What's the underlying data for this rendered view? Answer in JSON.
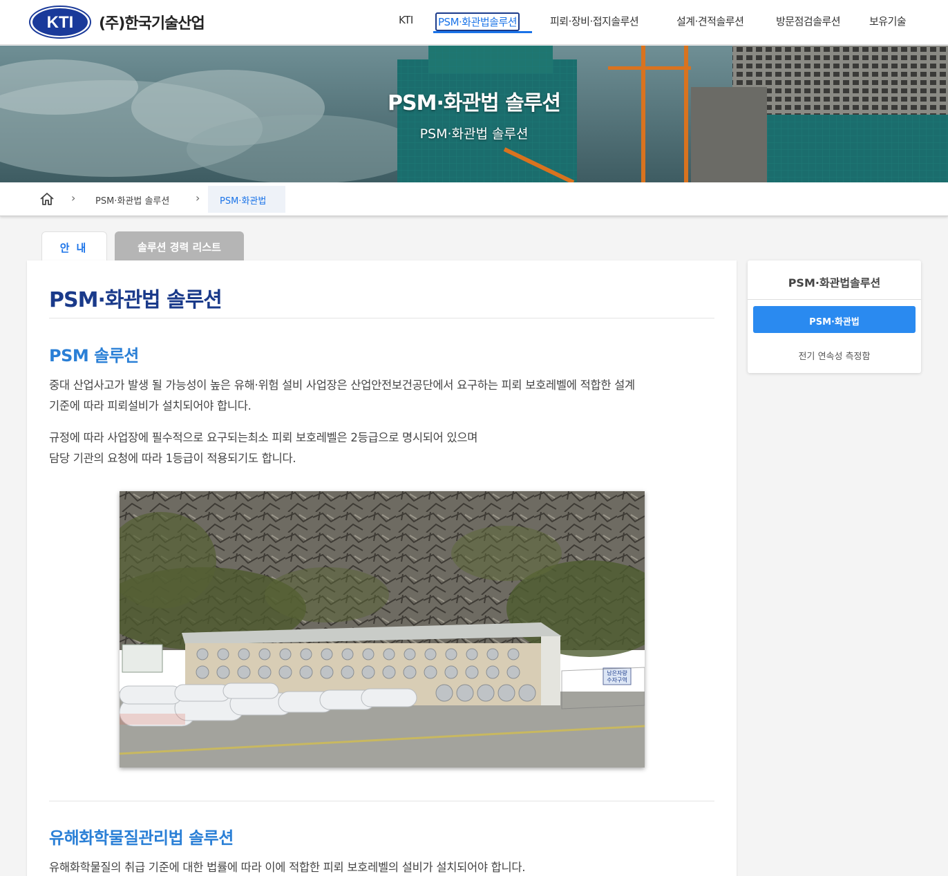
{
  "header": {
    "logo_text": "KTI",
    "company": "(주)한국기술산업",
    "nav": [
      {
        "label": "KTI"
      },
      {
        "label": "PSM·화관법솔루션"
      },
      {
        "label": "피뢰·장비·접지솔루션"
      },
      {
        "label": "설계·견적솔루션"
      },
      {
        "label": "방문점검솔루션"
      },
      {
        "label": "보유기술"
      }
    ],
    "active_nav_index": 1
  },
  "banner": {
    "title": "PSM·화관법 솔루션",
    "subtitle": "PSM·화관법 솔루션"
  },
  "breadcrumb": {
    "items": [
      "PSM·화관법 솔루션"
    ],
    "current": "PSM·화관법"
  },
  "tabs": [
    {
      "label": "안내",
      "active": true
    },
    {
      "label": "솔루션 경력 리스트",
      "active": false
    }
  ],
  "main": {
    "title": "PSM·화관법 솔루션",
    "section1": {
      "title": "PSM 솔루션",
      "para1_line1": "중대 산업사고가 발생 될 가능성이 높은 유해·위험 설비 사업장은 산업안전보건공단에서 요구하는 피뢰 보호레벨에 적합한 설계",
      "para1_line2": "기준에 따라 피뢰설비가 설치되어야 합니다.",
      "para2_line1": "규정에 따라 사업장에 필수적으로 요구되는최소 피뢰 보호레벨은 2등급으로 명시되어 있으며",
      "para2_line2": "담당 기관의 요청에 따라 1등급이 적용되기도 합니다."
    },
    "photo_sign": "남은자량\n수자구역",
    "section2": {
      "title": "유해화학물질관리법 솔루션",
      "para1": "유해화학물질의 취급 기준에 대한 법률에 따라 이에 적합한 피뢰 보호레벨의 설비가 설치되어야 합니다."
    }
  },
  "sidebar": {
    "title": "PSM·화관법솔루션",
    "items": [
      {
        "label": "PSM·화관법",
        "active": true
      },
      {
        "label": "전기 연속성 측정함",
        "active": false
      }
    ]
  },
  "colors": {
    "brand_blue": "#1a3a8a",
    "accent_blue": "#2a7fd6",
    "active_button": "#2a8af0"
  }
}
